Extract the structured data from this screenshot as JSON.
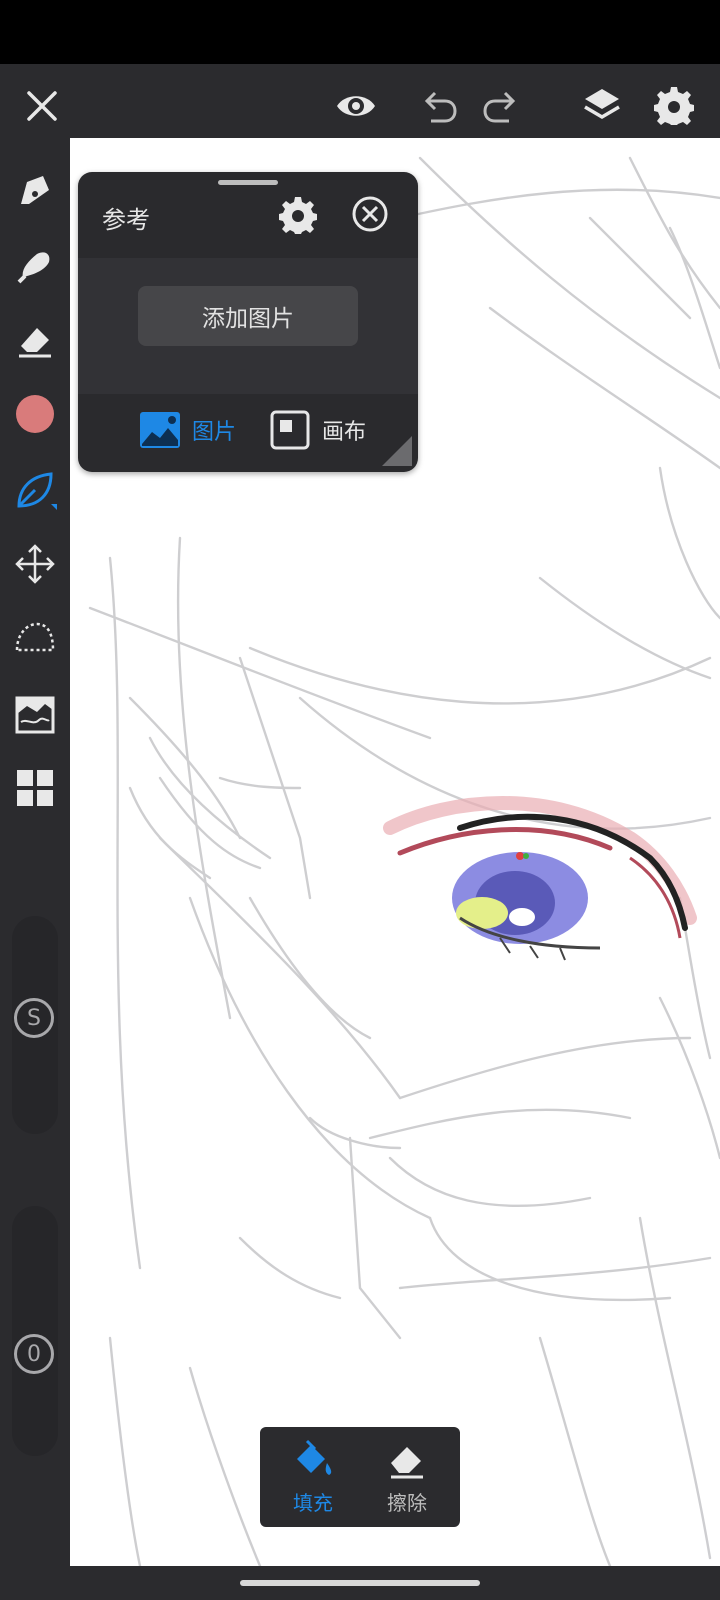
{
  "colors": {
    "toolbar_bg": "#2b2b2e",
    "accent": "#1e88e5",
    "brush_color": "#d97b7b",
    "icon": "#e8e8e8"
  },
  "topbar": {
    "icons": [
      "close-icon",
      "eye-icon",
      "undo-icon",
      "redo-icon",
      "layers-icon",
      "settings-icon"
    ]
  },
  "left_toolbar": {
    "tools": [
      "pen-icon",
      "brush-icon",
      "eraser-icon",
      "color-swatch",
      "fill-leaf-icon",
      "move-icon",
      "lasso-icon",
      "filter-icon",
      "grid-icon"
    ],
    "size_slider_label": "S",
    "opacity_slider_label": "0"
  },
  "reference_panel": {
    "title": "参考",
    "add_image_label": "添加图片",
    "tabs": [
      {
        "label": "图片",
        "active": true
      },
      {
        "label": "画布",
        "active": false
      }
    ]
  },
  "bottom_popup": {
    "items": [
      {
        "label": "填充",
        "active": true,
        "icon": "paint-bucket-icon"
      },
      {
        "label": "擦除",
        "active": false,
        "icon": "eraser-icon"
      }
    ]
  }
}
